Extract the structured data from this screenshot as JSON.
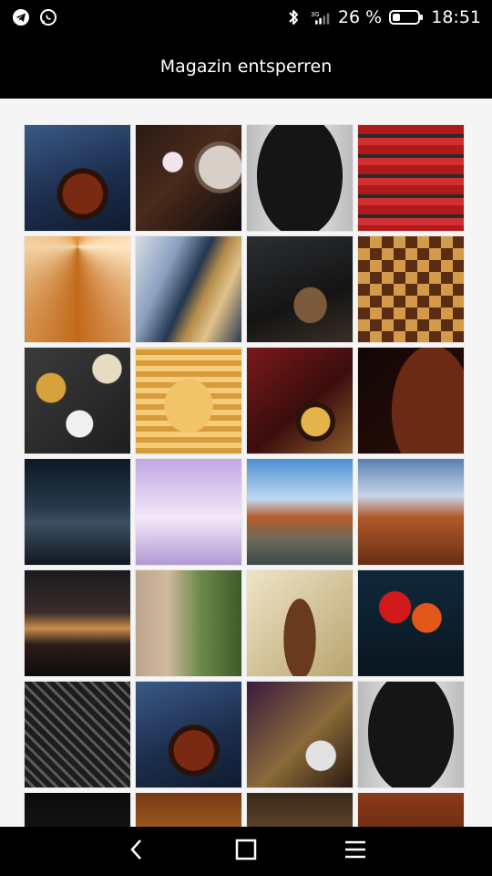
{
  "status_bar": {
    "left_icons": [
      "telegram-icon",
      "whatsapp-icon"
    ],
    "right_icons": [
      "bluetooth-icon",
      "signal-3g-icon"
    ],
    "battery_text": "26 %",
    "time": "18:51"
  },
  "header": {
    "title": "Magazin entsperren"
  },
  "gallery": {
    "tiles": [
      "tea",
      "blossom",
      "gown",
      "temple",
      "roof",
      "bldg",
      "chair",
      "chess",
      "spice",
      "waffle",
      "horn",
      "violin",
      "milky",
      "trees",
      "town",
      "desert",
      "mount",
      "alley",
      "vase",
      "roses",
      "moto",
      "tea",
      "film",
      "gown",
      "a",
      "b",
      "c",
      "d"
    ]
  },
  "nav": {
    "back_icon": "back-icon",
    "home_icon": "home-icon",
    "menu_icon": "menu-icon"
  },
  "colors": {
    "bar_bg": "#000000",
    "content_bg": "#f5f5f5",
    "text": "#ffffff"
  }
}
